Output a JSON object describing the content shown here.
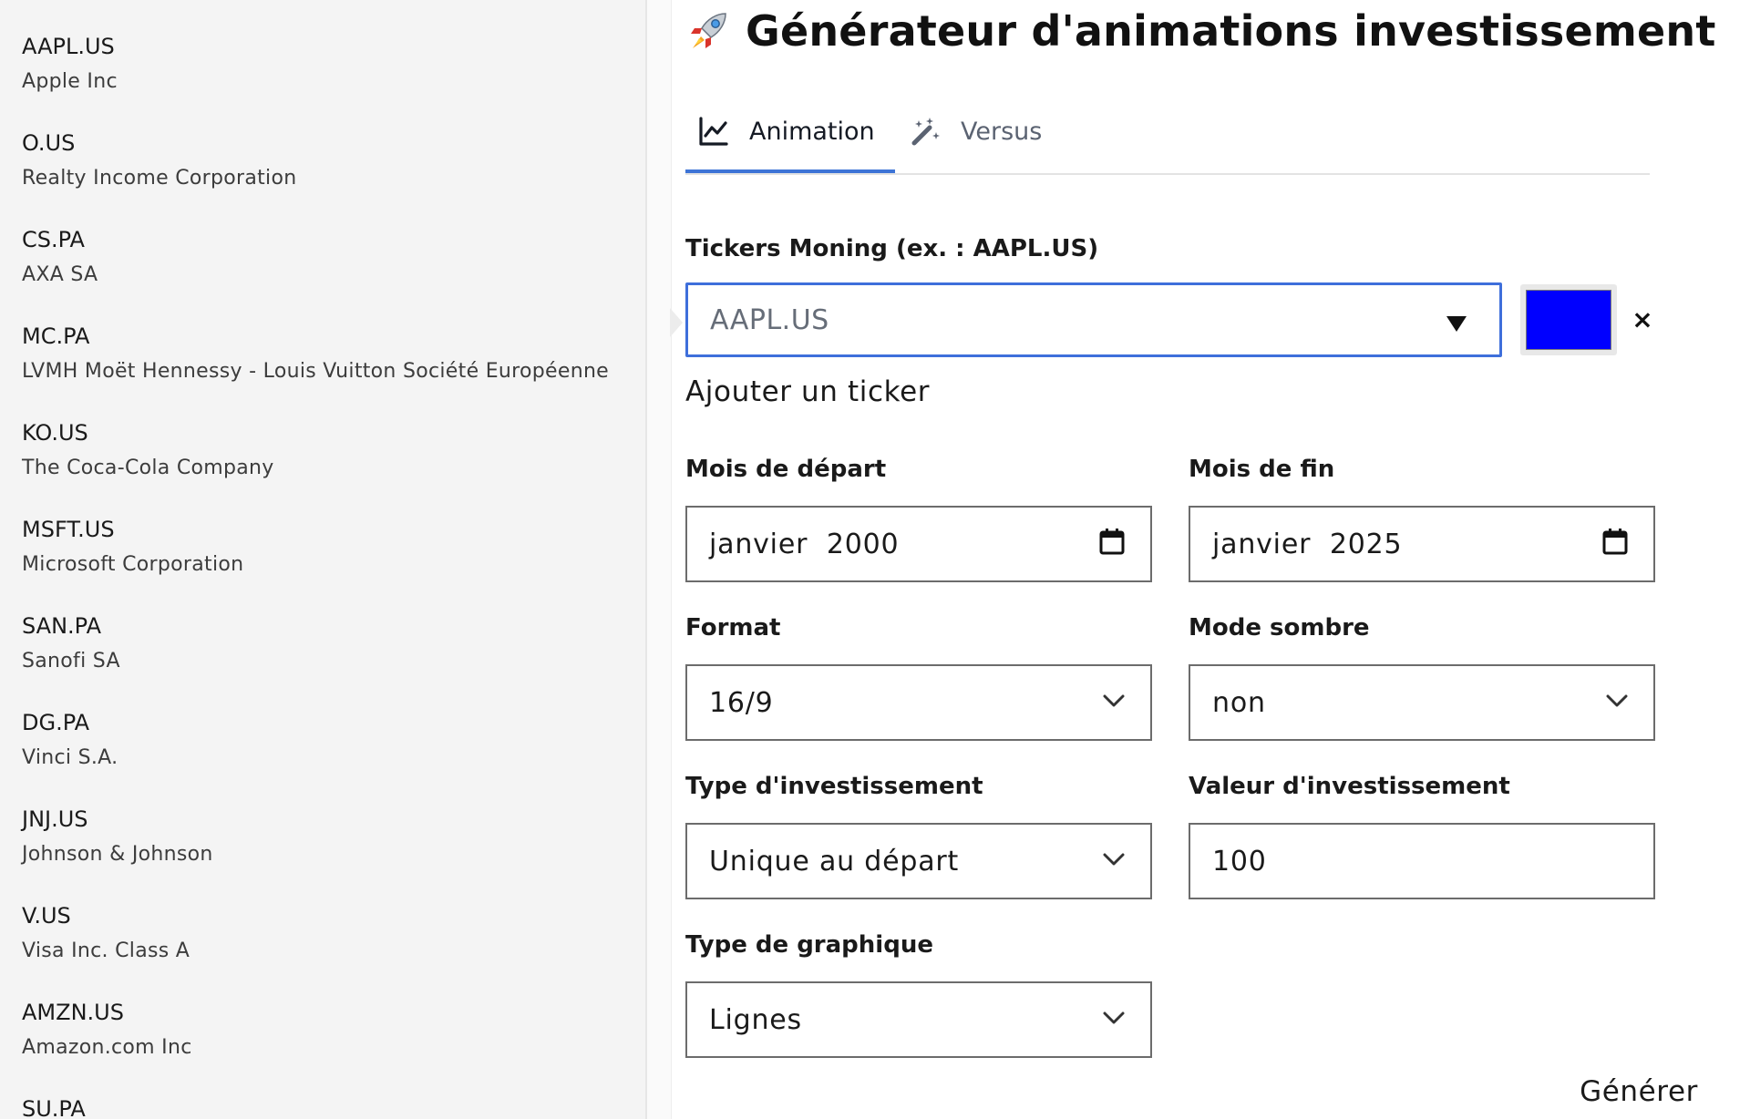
{
  "sidebar": {
    "items": [
      {
        "symbol": "AAPL.US",
        "name": "Apple Inc"
      },
      {
        "symbol": "O.US",
        "name": "Realty Income Corporation"
      },
      {
        "symbol": "CS.PA",
        "name": "AXA SA"
      },
      {
        "symbol": "MC.PA",
        "name": "LVMH Moët Hennessy - Louis Vuitton Société Européenne"
      },
      {
        "symbol": "KO.US",
        "name": "The Coca-Cola Company"
      },
      {
        "symbol": "MSFT.US",
        "name": "Microsoft Corporation"
      },
      {
        "symbol": "SAN.PA",
        "name": "Sanofi SA"
      },
      {
        "symbol": "DG.PA",
        "name": "Vinci S.A."
      },
      {
        "symbol": "JNJ.US",
        "name": "Johnson & Johnson"
      },
      {
        "symbol": "V.US",
        "name": "Visa Inc. Class A"
      },
      {
        "symbol": "AMZN.US",
        "name": "Amazon.com Inc"
      },
      {
        "symbol": "SU.PA",
        "name": ""
      }
    ]
  },
  "header": {
    "title": "Générateur d'animations investissement",
    "title_icon": "rocket-icon"
  },
  "tabs": [
    {
      "label": "Animation",
      "icon": "line-chart-icon",
      "active": true
    },
    {
      "label": "Versus",
      "icon": "magic-wand-icon",
      "active": false
    }
  ],
  "form": {
    "tickers_label": "Tickers Moning (ex. : AAPL.US)",
    "ticker_value": "AAPL.US",
    "ticker_color": "#0000ff",
    "remove_label": "×",
    "add_ticker_label": "Ajouter un ticker",
    "start_month_label": "Mois de départ",
    "start_month_value": "janvier  2000",
    "end_month_label": "Mois de fin",
    "end_month_value": "janvier  2025",
    "format_label": "Format",
    "format_value": "16/9",
    "dark_mode_label": "Mode sombre",
    "dark_mode_value": "non",
    "investment_type_label": "Type d'investissement",
    "investment_type_value": "Unique au départ",
    "investment_value_label": "Valeur d'investissement",
    "investment_value": "100",
    "chart_type_label": "Type de graphique",
    "chart_type_value": "Lignes",
    "generate_label": "Générer"
  },
  "colors": {
    "accent": "#3e74d6",
    "swatch": "#0000ff"
  }
}
